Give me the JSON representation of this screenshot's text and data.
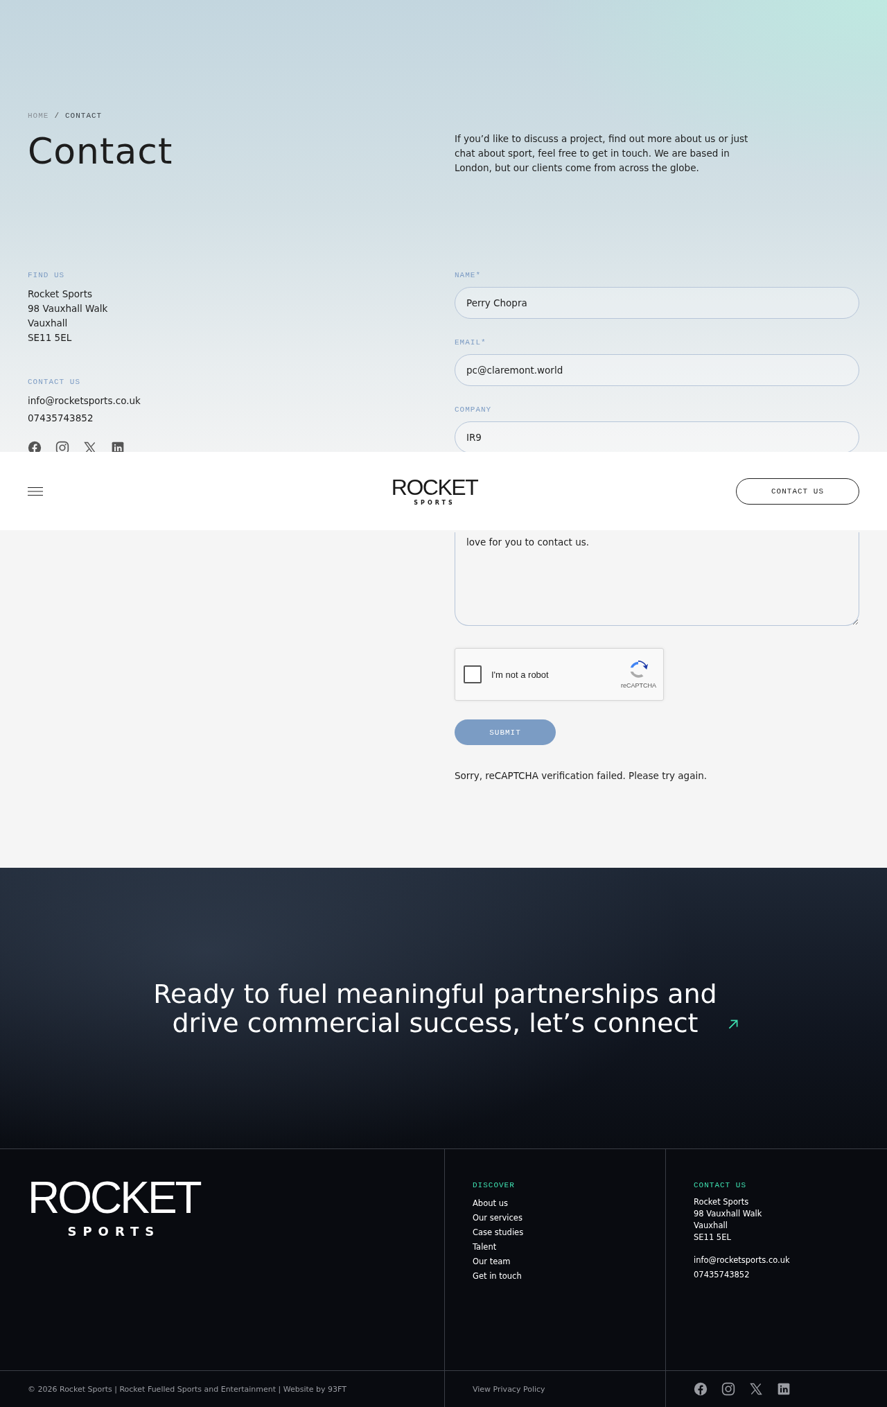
{
  "breadcrumb": {
    "separator": "/",
    "items": [
      {
        "label": "HOME",
        "current": false
      },
      {
        "label": "CONTACT",
        "current": true
      }
    ]
  },
  "title": "Contact",
  "intro": "If you’d like to discuss a project, find out more about us or just chat about sport, feel free to get in touch. We are based in London, but our clients come from across the globe.",
  "find_us": {
    "heading": "FIND US",
    "lines": [
      "Rocket Sports",
      "98 Vauxhall Walk",
      "Vauxhall",
      "SE11 5EL"
    ]
  },
  "contact_us": {
    "heading": "CONTACT US",
    "email": "info@rocketsports.co.uk",
    "phone": "07435743852"
  },
  "form": {
    "fields": [
      {
        "label": "NAME*",
        "value": "Perry Chopra"
      },
      {
        "label": "EMAIL*",
        "value": "pc@claremont.world"
      },
      {
        "label": "COMPANY",
        "value": "IR9"
      }
    ],
    "message": {
      "value": "love for you to contact us."
    },
    "captcha": {
      "label": "I'm not a robot",
      "brand": "reCAPTCHA",
      "checked": false
    },
    "submit": "SUBMIT",
    "error": "Sorry, reCAPTCHA verification failed. Please try again."
  },
  "header": {
    "logo": {
      "word": "ROCKET",
      "sub": "SPORTS"
    },
    "button": "CONTACT US"
  },
  "cta": {
    "text": "Ready to fuel meaningful partnerships and drive commercial success, let’s connect"
  },
  "footer": {
    "logo": {
      "word": "ROCKET",
      "sub": "SPORTS"
    },
    "discover": {
      "heading": "DISCOVER",
      "links": [
        "About us",
        "Our services",
        "Case studies",
        "Talent",
        "Our team",
        "Get in touch"
      ]
    },
    "contact": {
      "heading": "CONTACT US",
      "lines": [
        "Rocket Sports",
        "98 Vauxhall Walk",
        "Vauxhall",
        "SE11 5EL"
      ],
      "email": "info@rocketsports.co.uk",
      "phone": "07435743852"
    },
    "copyright": "© 2026 Rocket Sports | Rocket Fuelled Sports and Entertainment | Website by 93FT",
    "privacy": "View Privacy Policy"
  }
}
